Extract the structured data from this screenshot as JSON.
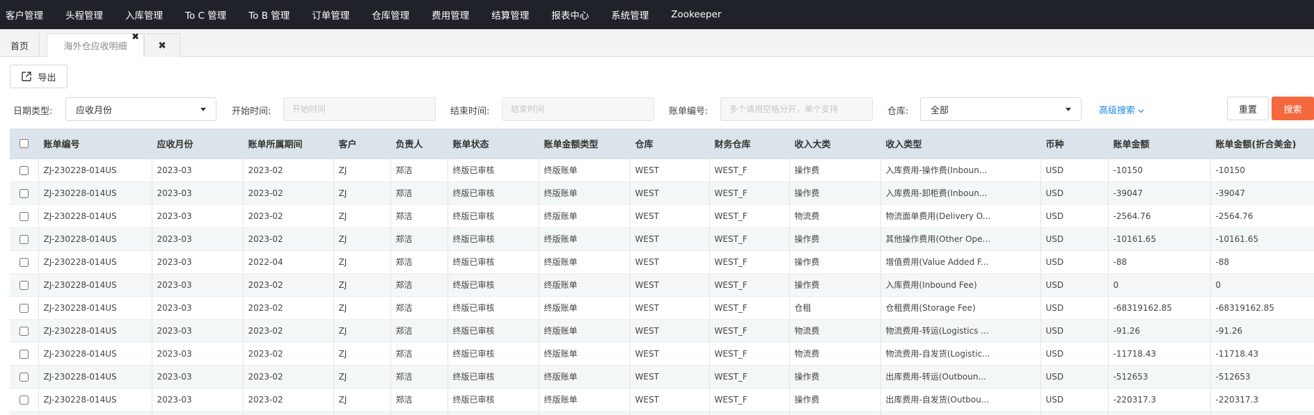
{
  "nav": {
    "items": [
      "客户管理",
      "头程管理",
      "入库管理",
      "To C 管理",
      "To B 管理",
      "订单管理",
      "仓库管理",
      "费用管理",
      "结算管理",
      "报表中心",
      "系统管理",
      "Zookeeper"
    ]
  },
  "tabs": {
    "home": "首页",
    "active": "海外仓应收明细",
    "close_icon": "✖",
    "close_all_icon": "✖"
  },
  "toolbar": {
    "export_label": "导出"
  },
  "filters": {
    "date_type_label": "日期类型:",
    "date_type_value": "应收月份",
    "start_label": "开始时间:",
    "start_placeholder": "开始时间",
    "end_label": "结束时间:",
    "end_placeholder": "结束时间",
    "bill_no_label": "账单编号:",
    "bill_no_placeholder": "多个请用空格分开，单个支持",
    "warehouse_label": "仓库:",
    "warehouse_value": "全部",
    "advanced_label": "高级搜索",
    "reset_label": "重置",
    "search_label": "搜索"
  },
  "table": {
    "columns": [
      "账单编号",
      "应收月份",
      "账单所属期间",
      "客户",
      "负责人",
      "账单状态",
      "账单金额类型",
      "仓库",
      "财务仓库",
      "收入大类",
      "收入类型",
      "币种",
      "账单金额",
      "账单金额(折合美金)"
    ],
    "rows": [
      [
        "ZJ-230228-014US",
        "2023-03",
        "2023-02",
        "ZJ",
        "郑洁",
        "终版已审核",
        "终版账单",
        "WEST",
        "WEST_F",
        "操作费",
        "入库费用-操作费(Inboun...",
        "USD",
        "-10150",
        "-10150"
      ],
      [
        "ZJ-230228-014US",
        "2023-03",
        "2023-02",
        "ZJ",
        "郑洁",
        "终版已审核",
        "终版账单",
        "WEST",
        "WEST_F",
        "操作费",
        "入库费用-卸柜费(Inboun...",
        "USD",
        "-39047",
        "-39047"
      ],
      [
        "ZJ-230228-014US",
        "2023-03",
        "2023-02",
        "ZJ",
        "郑洁",
        "终版已审核",
        "终版账单",
        "WEST",
        "WEST_F",
        "物流费",
        "物流面单费用(Delivery O...",
        "USD",
        "-2564.76",
        "-2564.76"
      ],
      [
        "ZJ-230228-014US",
        "2023-03",
        "2023-02",
        "ZJ",
        "郑洁",
        "终版已审核",
        "终版账单",
        "WEST",
        "WEST_F",
        "操作费",
        "其他操作费用(Other Ope...",
        "USD",
        "-10161.65",
        "-10161.65"
      ],
      [
        "ZJ-230228-014US",
        "2023-03",
        "2022-04",
        "ZJ",
        "郑洁",
        "终版已审核",
        "终版账单",
        "WEST",
        "WEST_F",
        "操作费",
        "增值费用(Value Added F...",
        "USD",
        "-88",
        "-88"
      ],
      [
        "ZJ-230228-014US",
        "2023-03",
        "2023-02",
        "ZJ",
        "郑洁",
        "终版已审核",
        "终版账单",
        "WEST",
        "WEST_F",
        "操作费",
        "入库费用(Inbound Fee)",
        "USD",
        "0",
        "0"
      ],
      [
        "ZJ-230228-014US",
        "2023-03",
        "2023-02",
        "ZJ",
        "郑洁",
        "终版已审核",
        "终版账单",
        "WEST",
        "WEST_F",
        "仓租",
        "仓租费用(Storage Fee)",
        "USD",
        "-68319162.85",
        "-68319162.85"
      ],
      [
        "ZJ-230228-014US",
        "2023-03",
        "2023-02",
        "ZJ",
        "郑洁",
        "终版已审核",
        "终版账单",
        "WEST",
        "WEST_F",
        "物流费",
        "物流费用-转运(Logistics ...",
        "USD",
        "-91.26",
        "-91.26"
      ],
      [
        "ZJ-230228-014US",
        "2023-03",
        "2023-02",
        "ZJ",
        "郑洁",
        "终版已审核",
        "终版账单",
        "WEST",
        "WEST_F",
        "物流费",
        "物流费用-自发货(Logistic...",
        "USD",
        "-11718.43",
        "-11718.43"
      ],
      [
        "ZJ-230228-014US",
        "2023-03",
        "2023-02",
        "ZJ",
        "郑洁",
        "终版已审核",
        "终版账单",
        "WEST",
        "WEST_F",
        "操作费",
        "出库费用-转运(Outboun...",
        "USD",
        "-512653",
        "-512653"
      ],
      [
        "ZJ-230228-014US",
        "2023-03",
        "2023-02",
        "ZJ",
        "郑洁",
        "终版已审核",
        "终版账单",
        "WEST",
        "WEST_F",
        "操作费",
        "出库费用-自发货(Outbou...",
        "USD",
        "-220317.3",
        "-220317.3"
      ],
      [
        "",
        "",
        "",
        "",
        "",
        "",
        "",
        "",
        "",
        "",
        "",
        "",
        "",
        ""
      ]
    ]
  },
  "colors": {
    "topnav_bg": "#1f2329",
    "header_bg": "#dbe4ea",
    "accent_search": "#f4683d",
    "link": "#1e88e5"
  }
}
